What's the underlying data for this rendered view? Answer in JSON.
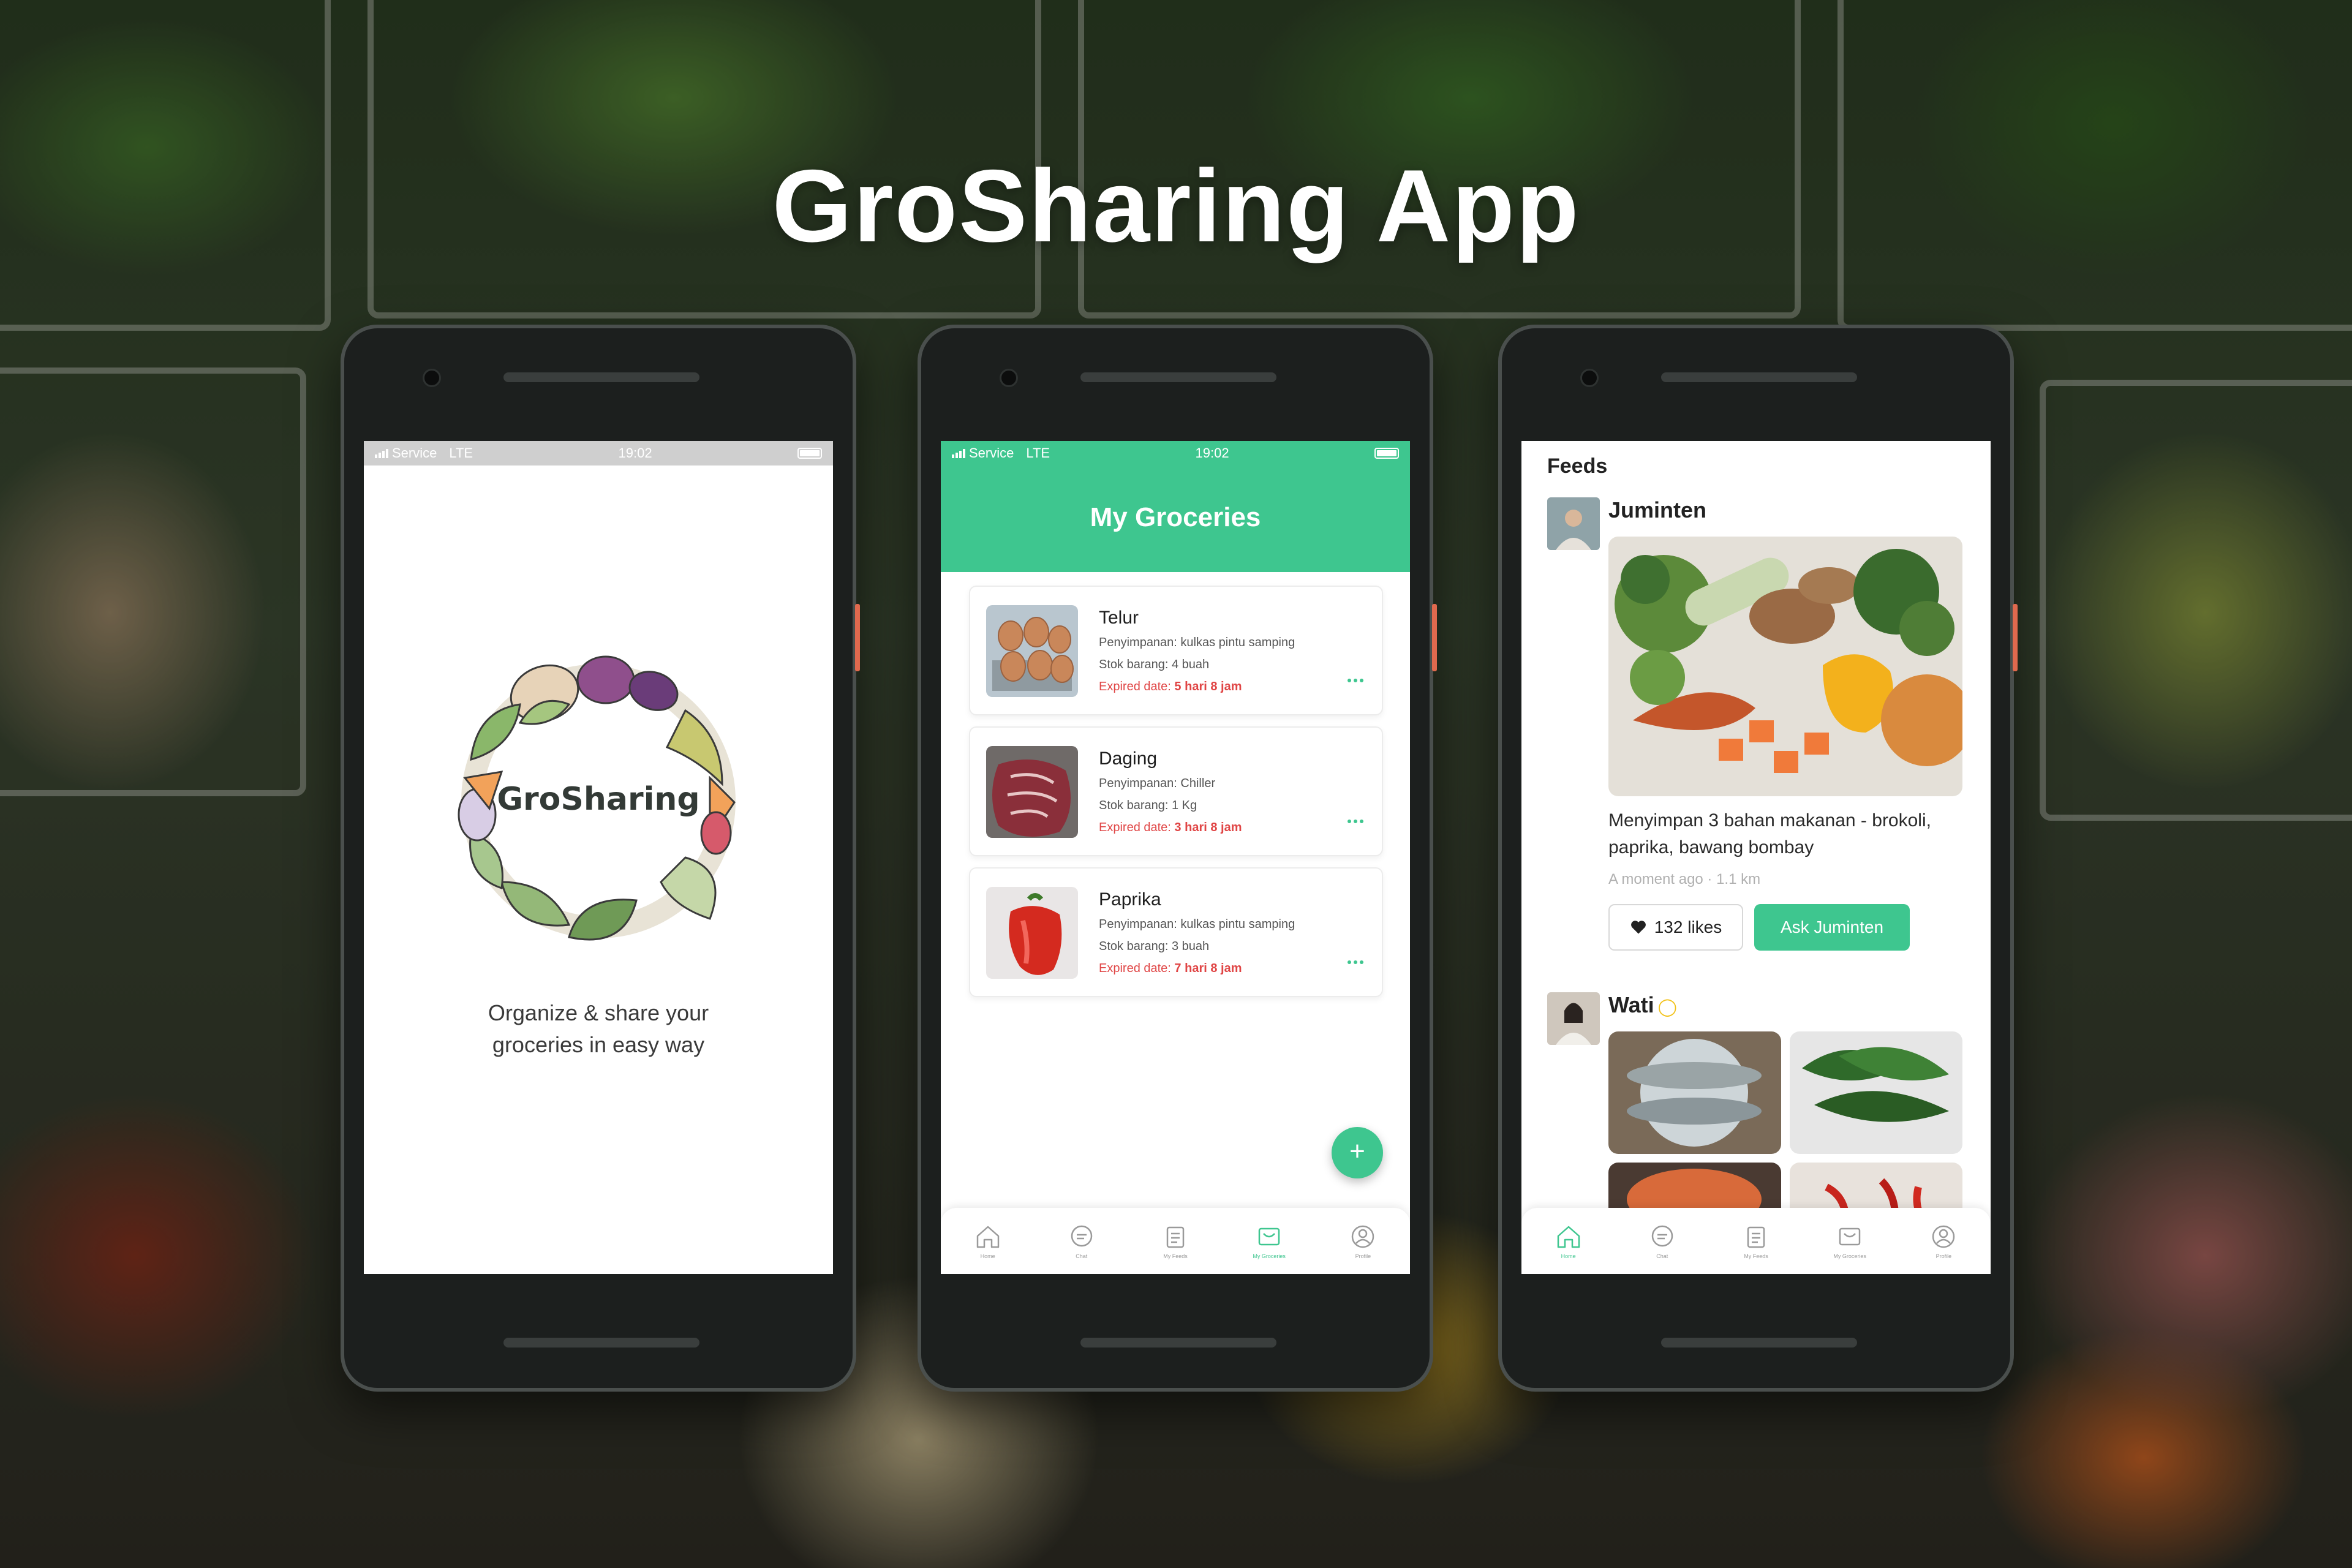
{
  "headline": "GroSharing App",
  "colors": {
    "brand_green": "#3ec68f",
    "expired_red": "#e04545"
  },
  "status_bar": {
    "carrier": "Service",
    "network": "LTE",
    "time": "19:02"
  },
  "splash": {
    "logo_text": "GroSharing",
    "tagline_line1": "Organize & share your",
    "tagline_line2": "groceries in easy way"
  },
  "groceries": {
    "title": "My Groceries",
    "items": [
      {
        "name": "Telur",
        "storage": "Penyimpanan: kulkas pintu samping",
        "stock": "Stok barang: 4 buah",
        "expired_label": "Expired date:",
        "expired_value": "5 hari 8 jam",
        "image": "eggs"
      },
      {
        "name": "Daging",
        "storage": "Penyimpanan: Chiller",
        "stock": "Stok barang: 1 Kg",
        "expired_label": "Expired date:",
        "expired_value": "3 hari 8 jam",
        "image": "meat"
      },
      {
        "name": "Paprika",
        "storage": "Penyimpanan: kulkas pintu samping",
        "stock": "Stok barang: 3 buah",
        "expired_label": "Expired date:",
        "expired_value": "7 hari 8 jam",
        "image": "red-pepper"
      }
    ],
    "fab_label": "+"
  },
  "nav": {
    "items": [
      {
        "label": "Home",
        "icon": "home-icon"
      },
      {
        "label": "Chat",
        "icon": "chat-icon"
      },
      {
        "label": "My Feeds",
        "icon": "feeds-icon"
      },
      {
        "label": "My Groceries",
        "icon": "groceries-icon"
      },
      {
        "label": "Profile",
        "icon": "profile-icon"
      }
    ]
  },
  "feeds": {
    "title": "Feeds",
    "posts": [
      {
        "user": "Juminten",
        "text": "Menyimpan 3 bahan makanan - brokoli, paprika, bawang bombay",
        "meta": "A moment ago · 1.1 km",
        "likes": "132 likes",
        "ask_label": "Ask Juminten"
      },
      {
        "user": "Wati"
      }
    ]
  }
}
